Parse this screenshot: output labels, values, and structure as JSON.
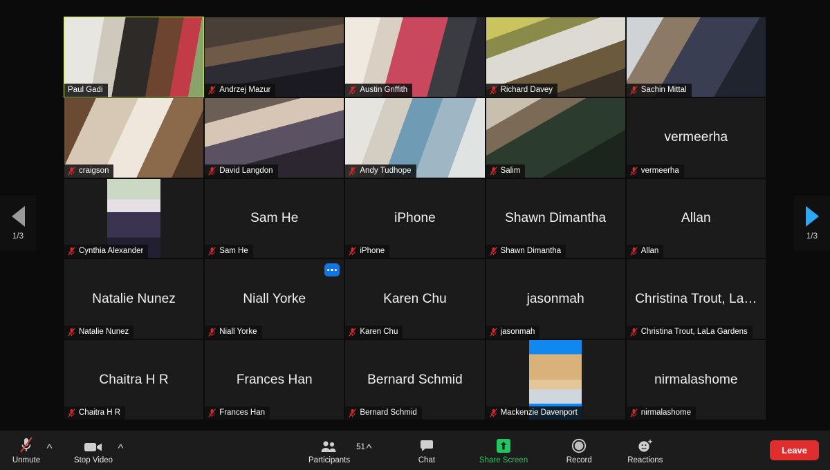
{
  "app": {
    "name": "Zoom Meeting",
    "view": "gallery"
  },
  "colors": {
    "active_speaker_border": "#c3e24a",
    "accent_blue": "#1275e0",
    "pager_next": "#2aa9f5",
    "pager_prev": "#9a9a9a",
    "share_screen_green": "#22c55e",
    "leave_red": "#e02d2d",
    "mic_off_red": "#d32b2b",
    "tile_bg": "#1b1b1b",
    "toolbar_bg": "#1c1c1c",
    "page_bg": "#0b0b0b"
  },
  "pager": {
    "prev": {
      "icon": "triangle-left-icon",
      "count": "1/3",
      "enabled": false
    },
    "next": {
      "icon": "triangle-right-icon",
      "count": "1/3",
      "enabled": true
    }
  },
  "more_options": {
    "icon": "ellipsis-icon",
    "label": "•••"
  },
  "participants": [
    {
      "name": "Paul Gadi",
      "muted": false,
      "video": true,
      "active_speaker": true,
      "kind": "video",
      "skin": "paul"
    },
    {
      "name": "Andrzej Mazur",
      "muted": true,
      "video": true,
      "active_speaker": false,
      "kind": "video",
      "skin": "andrzej"
    },
    {
      "name": "Austin Griffith",
      "muted": true,
      "video": true,
      "active_speaker": false,
      "kind": "video",
      "skin": "austin"
    },
    {
      "name": "Richard Davey",
      "muted": true,
      "video": true,
      "active_speaker": false,
      "kind": "video",
      "skin": "richard"
    },
    {
      "name": "Sachin Mittal",
      "muted": true,
      "video": true,
      "active_speaker": false,
      "kind": "video",
      "skin": "sachin"
    },
    {
      "name": "craigson",
      "muted": true,
      "video": true,
      "active_speaker": false,
      "kind": "video",
      "skin": "craigson"
    },
    {
      "name": "David Langdon",
      "muted": true,
      "video": true,
      "active_speaker": false,
      "kind": "video",
      "skin": "david"
    },
    {
      "name": "Andy Tudhope",
      "muted": true,
      "video": true,
      "active_speaker": false,
      "kind": "video",
      "skin": "andy"
    },
    {
      "name": "Salim",
      "muted": true,
      "video": true,
      "active_speaker": false,
      "kind": "video",
      "skin": "salim"
    },
    {
      "name": "vermeerha",
      "muted": true,
      "video": false,
      "active_speaker": false,
      "kind": "name",
      "display": "vermeerha"
    },
    {
      "name": "Cynthia Alexander",
      "muted": true,
      "video": false,
      "active_speaker": false,
      "kind": "avatar",
      "skin": "cynthia"
    },
    {
      "name": "Sam He",
      "muted": true,
      "video": false,
      "active_speaker": false,
      "kind": "name",
      "display": "Sam He"
    },
    {
      "name": "iPhone",
      "muted": true,
      "video": false,
      "active_speaker": false,
      "kind": "name",
      "display": "iPhone"
    },
    {
      "name": "Shawn Dimantha",
      "muted": true,
      "video": false,
      "active_speaker": false,
      "kind": "name",
      "display": "Shawn Dimantha"
    },
    {
      "name": "Allan",
      "muted": true,
      "video": false,
      "active_speaker": false,
      "kind": "name",
      "display": "Allan"
    },
    {
      "name": "Natalie Nunez",
      "muted": true,
      "video": false,
      "active_speaker": false,
      "kind": "name",
      "display": "Natalie Nunez"
    },
    {
      "name": "Niall Yorke",
      "muted": true,
      "video": false,
      "active_speaker": false,
      "kind": "name",
      "display": "Niall Yorke"
    },
    {
      "name": "Karen Chu",
      "muted": true,
      "video": false,
      "active_speaker": false,
      "kind": "name",
      "display": "Karen Chu"
    },
    {
      "name": "jasonmah",
      "muted": true,
      "video": false,
      "active_speaker": false,
      "kind": "name",
      "display": "jasonmah"
    },
    {
      "name": "Christina Trout, LaLa Gardens",
      "muted": true,
      "video": false,
      "active_speaker": false,
      "kind": "name",
      "display": "Christina Trout, La…"
    },
    {
      "name": "Chaitra H R",
      "muted": true,
      "video": false,
      "active_speaker": false,
      "kind": "name",
      "display": "Chaitra H R"
    },
    {
      "name": "Frances Han",
      "muted": true,
      "video": false,
      "active_speaker": false,
      "kind": "name",
      "display": "Frances Han"
    },
    {
      "name": "Bernard Schmid",
      "muted": true,
      "video": false,
      "active_speaker": false,
      "kind": "name",
      "display": "Bernard Schmid"
    },
    {
      "name": "Mackenzie Davenport",
      "muted": true,
      "video": false,
      "active_speaker": false,
      "kind": "avatar",
      "skin": "mackenzie"
    },
    {
      "name": "nirmalashome",
      "muted": true,
      "video": false,
      "active_speaker": false,
      "kind": "name",
      "display": "nirmalashome"
    }
  ],
  "toolbar": {
    "audio": {
      "label": "Unmute",
      "icon": "mic-off-icon",
      "caret": "˄"
    },
    "video": {
      "label": "Stop Video",
      "icon": "camera-icon",
      "caret": "˄"
    },
    "participants": {
      "label": "Participants",
      "icon": "people-icon",
      "count": "51",
      "caret": "˄"
    },
    "chat": {
      "label": "Chat",
      "icon": "chat-bubble-icon"
    },
    "share": {
      "label": "Share Screen",
      "icon": "share-screen-icon"
    },
    "record": {
      "label": "Record",
      "icon": "record-circle-icon"
    },
    "reactions": {
      "label": "Reactions",
      "icon": "reactions-icon"
    },
    "leave": {
      "label": "Leave"
    }
  }
}
